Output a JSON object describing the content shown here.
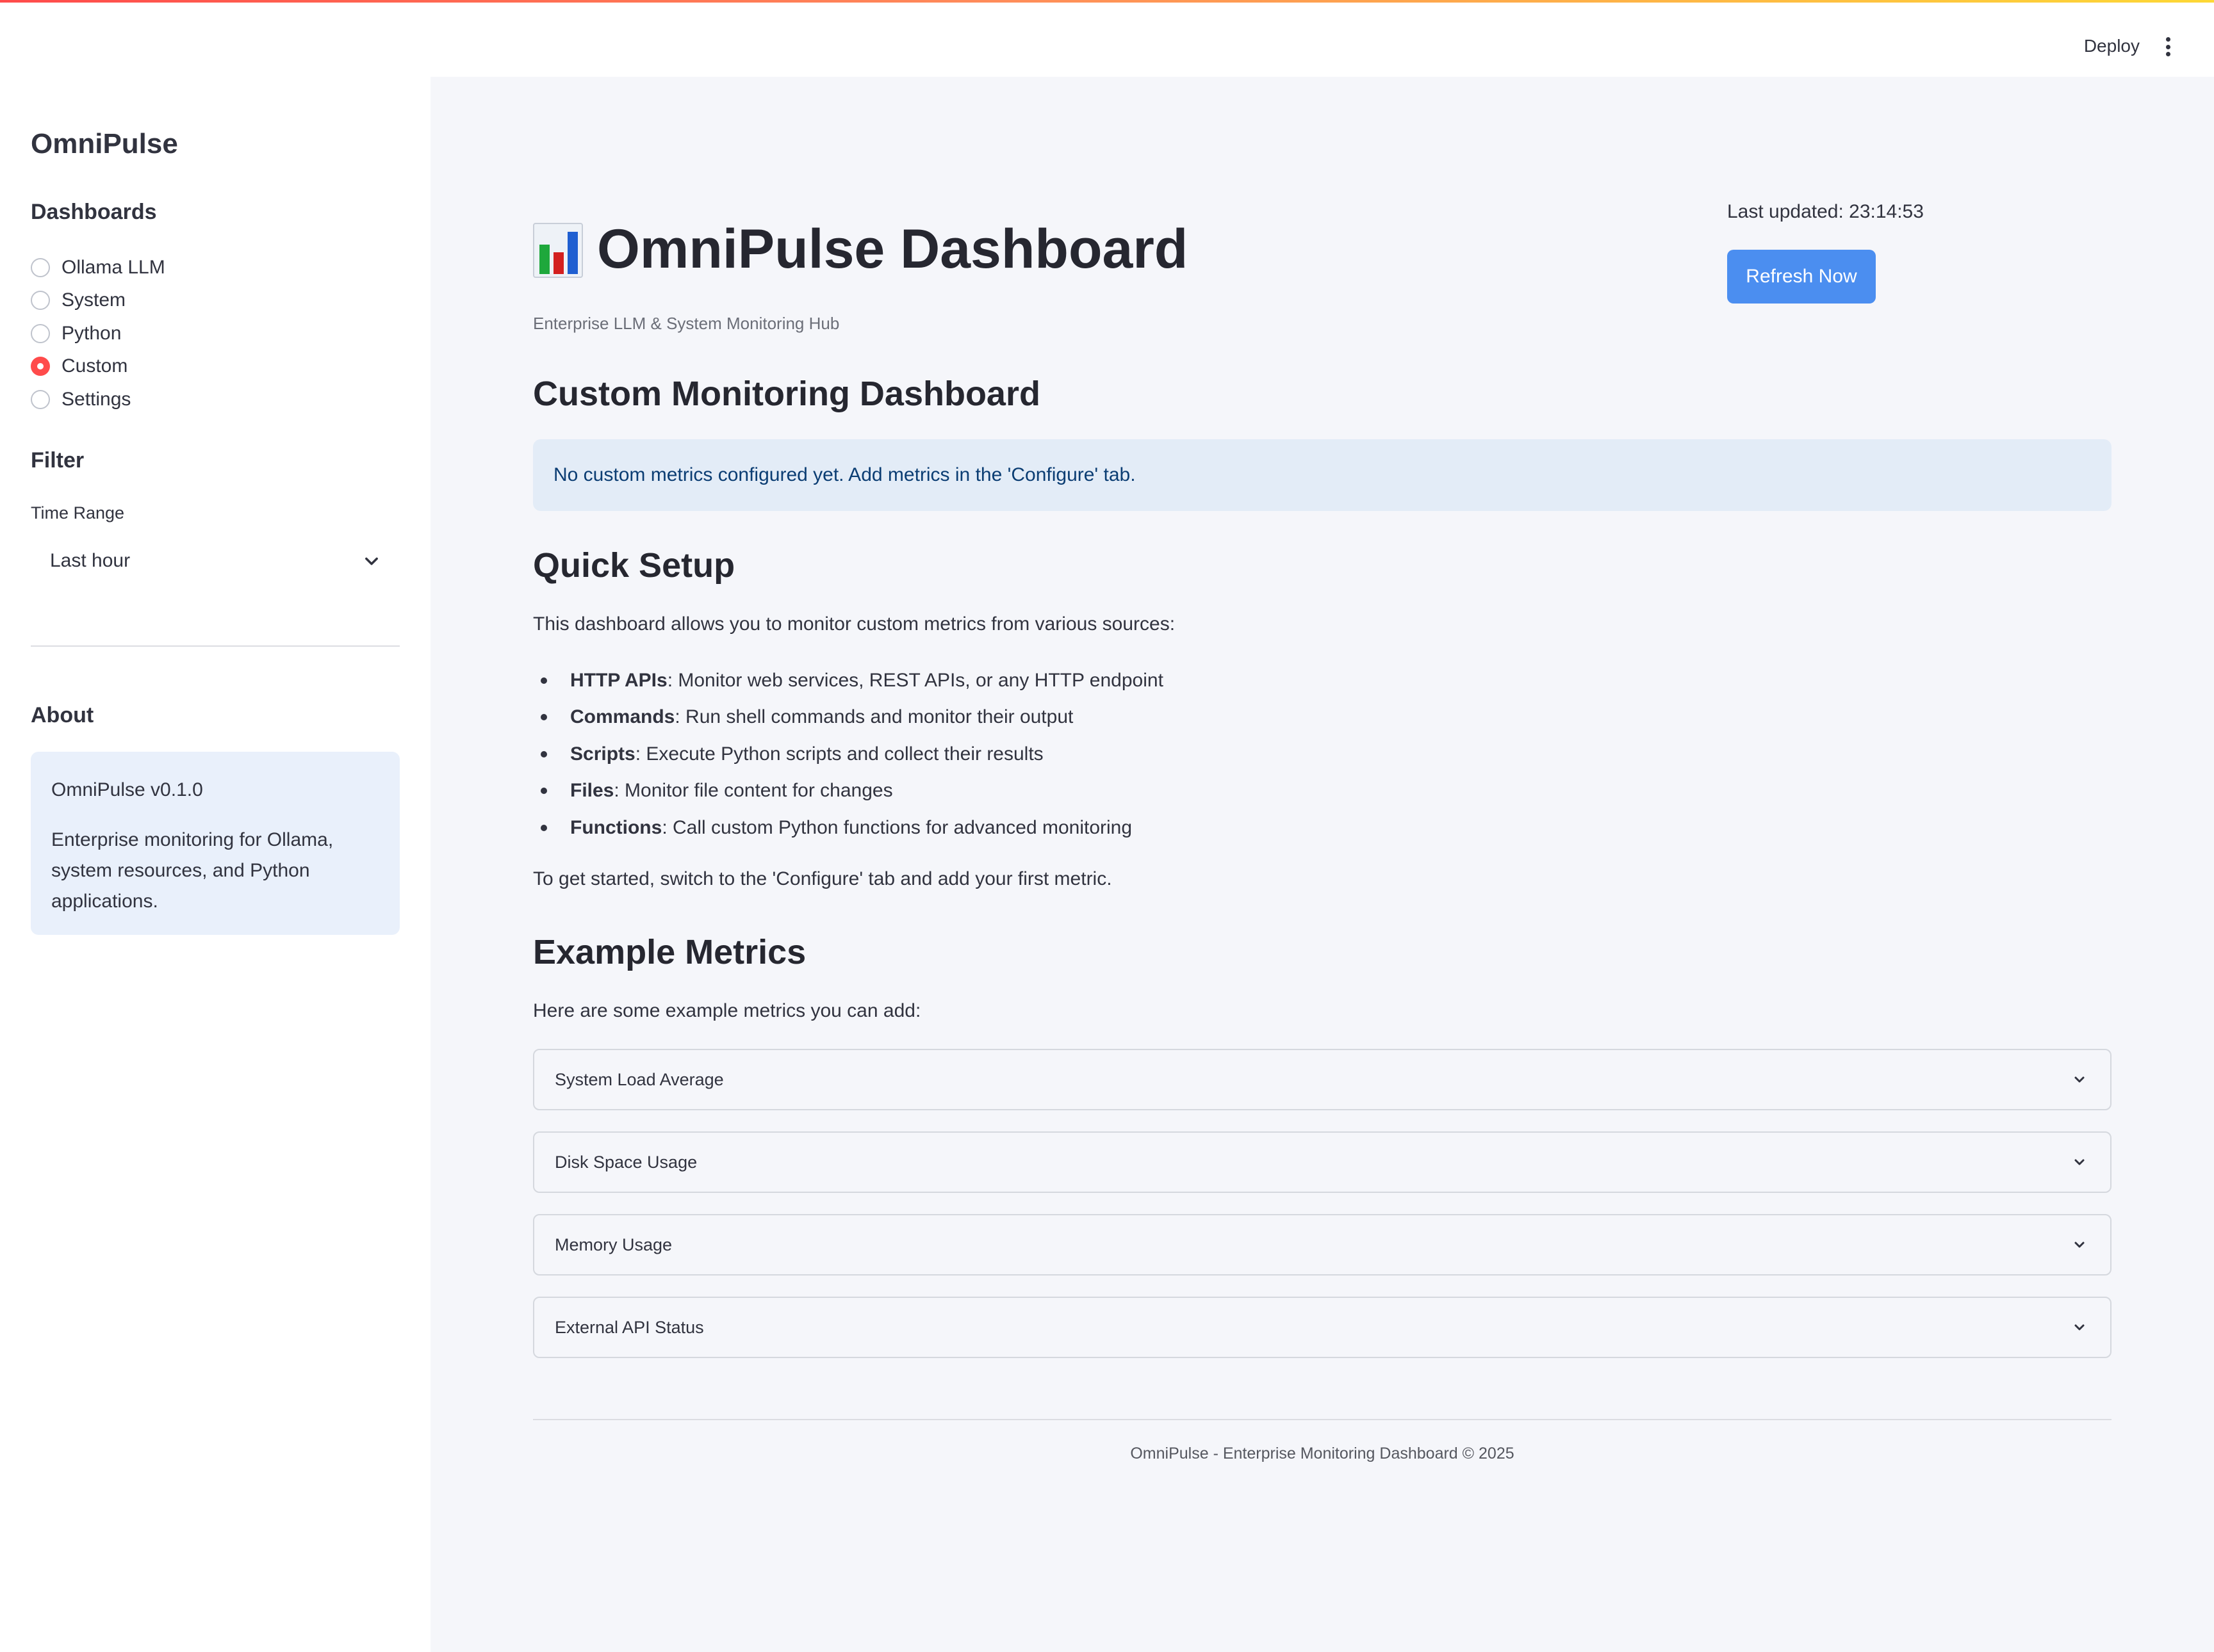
{
  "header": {
    "deploy_label": "Deploy",
    "menu_icon": "kebab-menu-icon"
  },
  "sidebar": {
    "app_title": "OmniPulse",
    "dashboards_heading": "Dashboards",
    "dashboards": [
      {
        "label": "Ollama LLM",
        "selected": false
      },
      {
        "label": "System",
        "selected": false
      },
      {
        "label": "Python",
        "selected": false
      },
      {
        "label": "Custom",
        "selected": true
      },
      {
        "label": "Settings",
        "selected": false
      }
    ],
    "filter_heading": "Filter",
    "time_range_label": "Time Range",
    "time_range_value": "Last hour",
    "about_heading": "About",
    "about_version": "OmniPulse v0.1.0",
    "about_text": "Enterprise monitoring for Ollama, system resources, and Python applications."
  },
  "main": {
    "title_icon": "bar-chart-icon",
    "title": "OmniPulse Dashboard",
    "subtitle": "Enterprise LLM & System Monitoring Hub",
    "last_updated": "Last updated: 23:14:53",
    "refresh_label": "Refresh Now",
    "section_title": "Custom Monitoring Dashboard",
    "info_message": "No custom metrics configured yet. Add metrics in the 'Configure' tab.",
    "quick_setup": {
      "heading": "Quick Setup",
      "intro": "This dashboard allows you to monitor custom metrics from various sources:",
      "items": [
        {
          "term": "HTTP APIs",
          "desc": ": Monitor web services, REST APIs, or any HTTP endpoint"
        },
        {
          "term": "Commands",
          "desc": ": Run shell commands and monitor their output"
        },
        {
          "term": "Scripts",
          "desc": ": Execute Python scripts and collect their results"
        },
        {
          "term": "Files",
          "desc": ": Monitor file content for changes"
        },
        {
          "term": "Functions",
          "desc": ": Call custom Python functions for advanced monitoring"
        }
      ],
      "outro": "To get started, switch to the 'Configure' tab and add your first metric."
    },
    "examples": {
      "heading": "Example Metrics",
      "intro": "Here are some example metrics you can add:",
      "items": [
        "System Load Average",
        "Disk Space Usage",
        "Memory Usage",
        "External API Status"
      ]
    },
    "footer": "OmniPulse - Enterprise Monitoring Dashboard © 2025"
  },
  "colors": {
    "accent": "#ff4b4b",
    "button": "#4b8ef0",
    "info_bg": "#e3ecf7",
    "info_text": "#0b3d73"
  }
}
